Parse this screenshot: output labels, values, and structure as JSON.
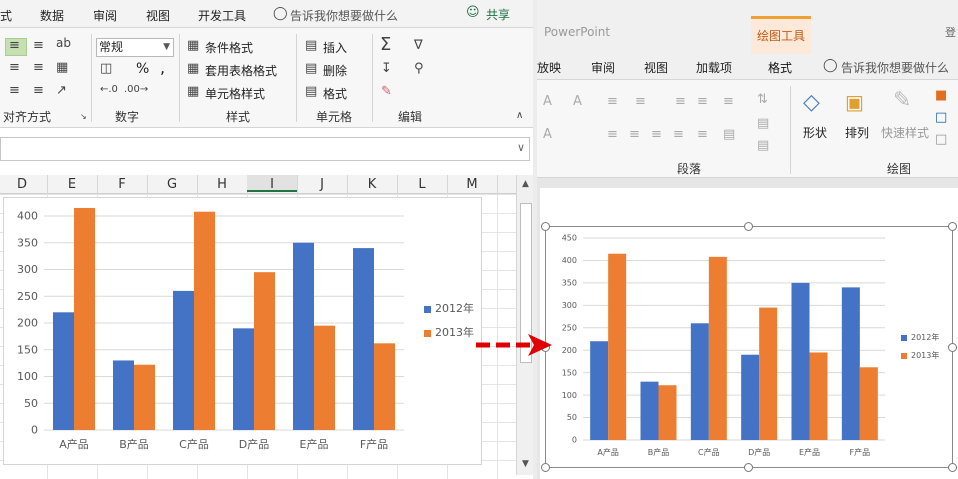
{
  "excel": {
    "tabs": [
      "式",
      "数据",
      "审阅",
      "视图",
      "开发工具"
    ],
    "tell_me": "告诉我你想要做什么",
    "share": "共享",
    "groups": [
      "对齐方式",
      "数字",
      "样式",
      "单元格",
      "编辑"
    ],
    "number_format": "常规",
    "percent": "%",
    "comma": ",",
    "style_items": [
      "条件格式",
      "套用表格格式",
      "单元格样式"
    ],
    "cell_items": [
      "插入",
      "删除",
      "格式"
    ],
    "columns": [
      "D",
      "E",
      "F",
      "G",
      "H",
      "I",
      "J",
      "K",
      "L",
      "M"
    ],
    "selected_column": "I"
  },
  "ppt": {
    "app_name": "PowerPoint",
    "context_tab": "绘图工具",
    "right_stub": "登",
    "tabs": [
      "放映",
      "审阅",
      "视图",
      "加载项",
      "格式"
    ],
    "active_tab": "格式",
    "tell_me": "告诉我你想要做什么",
    "groups": [
      "段落",
      "绘图"
    ],
    "drawing_items": [
      "形状",
      "排列",
      "快速样式"
    ]
  },
  "chart_data": [
    {
      "type": "bar",
      "categories": [
        "A产品",
        "B产品",
        "C产品",
        "D产品",
        "E产品",
        "F产品"
      ],
      "series": [
        {
          "name": "2012年",
          "values": [
            220,
            130,
            260,
            190,
            350,
            340
          ],
          "color": "#4472C4"
        },
        {
          "name": "2013年",
          "values": [
            415,
            122,
            408,
            295,
            195,
            162
          ],
          "color": "#ED7D31"
        }
      ],
      "ylim": [
        0,
        400
      ],
      "yticks": [
        0,
        50,
        100,
        150,
        200,
        250,
        300,
        350,
        400
      ],
      "grid": true,
      "legend": "right"
    },
    {
      "type": "bar",
      "categories": [
        "A产品",
        "B产品",
        "C产品",
        "D产品",
        "E产品",
        "F产品"
      ],
      "series": [
        {
          "name": "2012年",
          "values": [
            220,
            130,
            260,
            190,
            350,
            340
          ],
          "color": "#4472C4"
        },
        {
          "name": "2013年",
          "values": [
            415,
            122,
            408,
            295,
            195,
            162
          ],
          "color": "#ED7D31"
        }
      ],
      "ylim": [
        0,
        450
      ],
      "yticks": [
        0,
        50,
        100,
        150,
        200,
        250,
        300,
        350,
        400,
        450
      ],
      "grid": true,
      "legend": "right"
    }
  ],
  "colors": {
    "excel_green": "#217346",
    "ppt_context": "#c55a11",
    "arrow_red": "#e00000"
  }
}
